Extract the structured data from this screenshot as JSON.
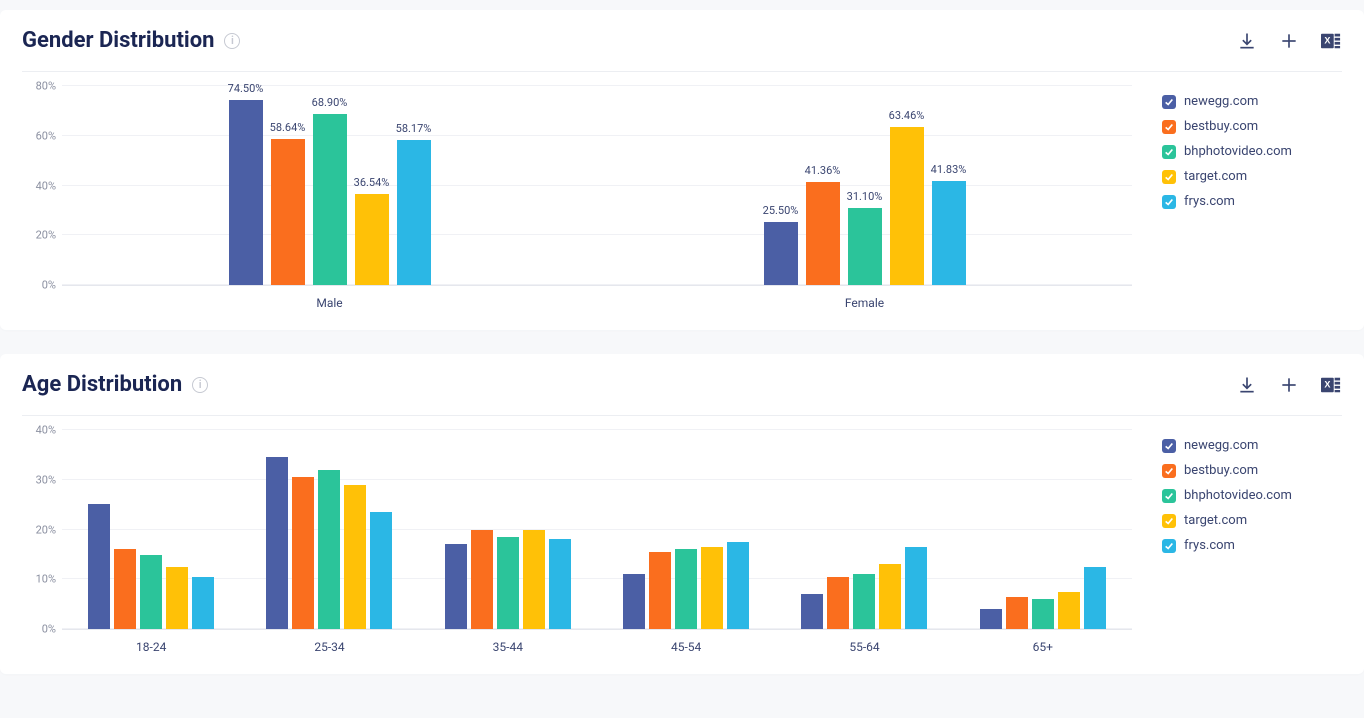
{
  "colors": {
    "newegg": "#4b5fa5",
    "bestbuy": "#fa6e1e",
    "bhphotovideo": "#2bc49a",
    "target": "#ffc107",
    "frys": "#2bb7e5"
  },
  "series": [
    {
      "key": "newegg",
      "label": "newegg.com"
    },
    {
      "key": "bestbuy",
      "label": "bestbuy.com"
    },
    {
      "key": "bhphotovideo",
      "label": "bhphotovideo.com"
    },
    {
      "key": "target",
      "label": "target.com"
    },
    {
      "key": "frys",
      "label": "frys.com"
    }
  ],
  "gender": {
    "title": "Gender Distribution",
    "ylim": [
      0,
      80
    ],
    "yticks": [
      0,
      20,
      40,
      60,
      80
    ],
    "categories": [
      "Male",
      "Female"
    ],
    "data": {
      "newegg": [
        74.5,
        25.5
      ],
      "bestbuy": [
        58.64,
        41.36
      ],
      "bhphotovideo": [
        68.9,
        31.1
      ],
      "target": [
        36.54,
        63.46
      ],
      "frys": [
        58.17,
        41.83
      ]
    }
  },
  "age": {
    "title": "Age Distribution",
    "ylim": [
      0,
      40
    ],
    "yticks": [
      0,
      10,
      20,
      30,
      40
    ],
    "categories": [
      "18-24",
      "25-34",
      "35-44",
      "45-54",
      "55-64",
      "65+"
    ],
    "data": {
      "newegg": [
        25.2,
        34.5,
        17.0,
        11.0,
        7.0,
        4.0
      ],
      "bestbuy": [
        16.0,
        30.5,
        20.0,
        15.5,
        10.5,
        6.5
      ],
      "bhphotovideo": [
        14.8,
        32.0,
        18.5,
        16.0,
        11.0,
        6.0
      ],
      "target": [
        12.5,
        29.0,
        20.0,
        16.5,
        13.0,
        7.5
      ],
      "frys": [
        10.5,
        23.5,
        18.0,
        17.5,
        16.5,
        12.5
      ]
    }
  },
  "chart_data": [
    {
      "type": "bar",
      "title": "Gender Distribution",
      "categories": [
        "Male",
        "Female"
      ],
      "series": [
        {
          "name": "newegg.com",
          "values": [
            74.5,
            25.5
          ]
        },
        {
          "name": "bestbuy.com",
          "values": [
            58.64,
            41.36
          ]
        },
        {
          "name": "bhphotovideo.com",
          "values": [
            68.9,
            31.1
          ]
        },
        {
          "name": "target.com",
          "values": [
            36.54,
            63.46
          ]
        },
        {
          "name": "frys.com",
          "values": [
            58.17,
            41.83
          ]
        }
      ],
      "xlabel": "",
      "ylabel": "",
      "ylim": [
        0,
        80
      ]
    },
    {
      "type": "bar",
      "title": "Age Distribution",
      "categories": [
        "18-24",
        "25-34",
        "35-44",
        "45-54",
        "55-64",
        "65+"
      ],
      "series": [
        {
          "name": "newegg.com",
          "values": [
            25.2,
            34.5,
            17.0,
            11.0,
            7.0,
            4.0
          ]
        },
        {
          "name": "bestbuy.com",
          "values": [
            16.0,
            30.5,
            20.0,
            15.5,
            10.5,
            6.5
          ]
        },
        {
          "name": "bhphotovideo.com",
          "values": [
            14.8,
            32.0,
            18.5,
            16.0,
            11.0,
            6.0
          ]
        },
        {
          "name": "target.com",
          "values": [
            12.5,
            29.0,
            20.0,
            16.5,
            13.0,
            7.5
          ]
        },
        {
          "name": "frys.com",
          "values": [
            10.5,
            23.5,
            18.0,
            17.5,
            16.5,
            12.5
          ]
        }
      ],
      "xlabel": "",
      "ylabel": "",
      "ylim": [
        0,
        40
      ]
    }
  ]
}
